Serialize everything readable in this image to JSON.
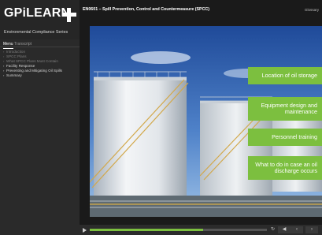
{
  "brand": {
    "logo_text": "GPiLEARN",
    "series": "Environmental Compliance Series"
  },
  "sidebar": {
    "tabs": [
      {
        "label": "Menu",
        "active": true
      },
      {
        "label": "Transcript",
        "active": false
      }
    ],
    "items": [
      {
        "label": "Introduction",
        "state": "visited"
      },
      {
        "label": "SPCC Plans",
        "state": "visited"
      },
      {
        "label": "What SPCC Plans Must Contain",
        "state": "visited"
      },
      {
        "label": "Facility Response",
        "state": "done"
      },
      {
        "label": "Preventing and Mitigating Oil Spills",
        "state": "done"
      },
      {
        "label": "Summary",
        "state": "done"
      }
    ]
  },
  "header": {
    "course_title": "EN0601 – Spill Prevention, Control and Countermeasure (SPCC)",
    "glossary_label": "Glossary"
  },
  "slide": {
    "cards": [
      "Location of oil storage",
      "Equipment design and maintenance",
      "Personnel training",
      "What to do in case an oil discharge occurs"
    ]
  },
  "controls": {
    "progress": 0.64,
    "replay_icon": "replay-icon",
    "back_icon": "volume-icon",
    "prev_icon": "prev-icon",
    "next_icon": "next-icon"
  },
  "colors": {
    "accent": "#7cbf3f",
    "sidebar_bg": "#2a2a2a",
    "stage_bg": "#1a1a1a"
  }
}
